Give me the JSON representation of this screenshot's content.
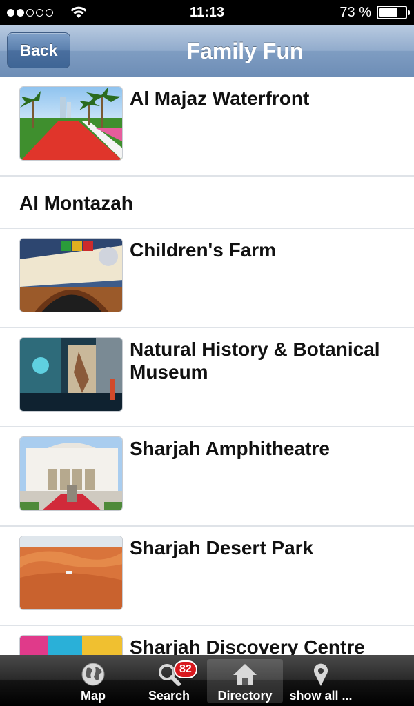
{
  "status_bar": {
    "time": "11:13",
    "battery_text": "73 %",
    "battery_level": 0.73,
    "signal_bars_filled": 2,
    "signal_bars_total": 5
  },
  "nav": {
    "back_label": "Back",
    "title": "Family Fun"
  },
  "list": {
    "items": [
      {
        "title": "Al Majaz Waterfront",
        "thumbnail": "palm-promenade-photo"
      },
      {
        "title": "Al Montazah"
      },
      {
        "title": "Children's Farm",
        "thumbnail": "childrens-farm-sign-photo"
      },
      {
        "title": "Natural History & Botanical Museum",
        "thumbnail": "museum-interior-photo"
      },
      {
        "title": "Sharjah Amphitheatre",
        "thumbnail": "amphitheatre-building-photo"
      },
      {
        "title": "Sharjah Desert Park",
        "thumbnail": "desert-dunes-photo"
      },
      {
        "title": "Sharjah Discovery Centre",
        "thumbnail": "discovery-centre-photo"
      }
    ]
  },
  "tab_bar": {
    "tabs": [
      {
        "label": "Map",
        "icon": "globe-icon"
      },
      {
        "label": "Search",
        "icon": "magnifier-icon",
        "badge": "82"
      },
      {
        "label": "Directory",
        "icon": "house-icon",
        "active": true
      },
      {
        "label": "show all ...",
        "icon": "location-pin-icon"
      }
    ]
  },
  "colors": {
    "nav_gradient_top": "#b9cbe1",
    "nav_gradient_bottom": "#6d8db6",
    "badge_red": "#d8181e",
    "separator": "#dfe3e8"
  }
}
